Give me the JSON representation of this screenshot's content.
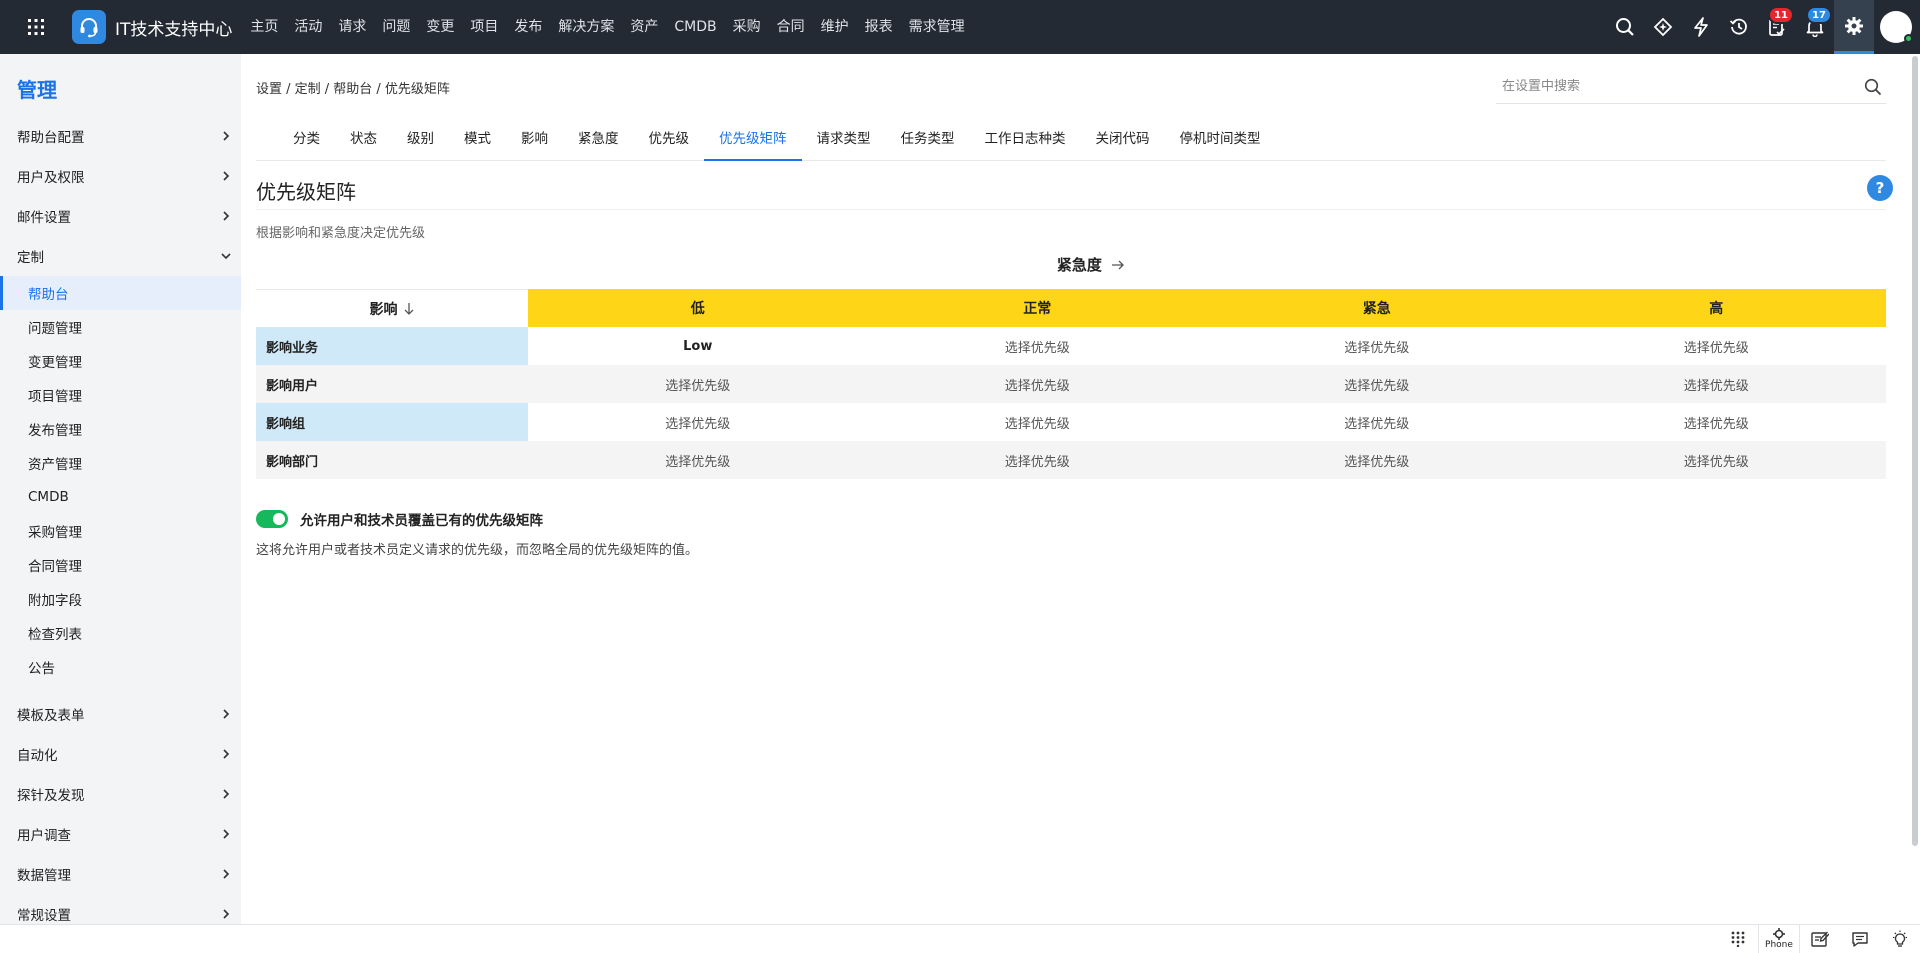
{
  "app": {
    "title": "IT技术支持中心",
    "accent": "#2f89e0",
    "topbar_bg": "#232a33"
  },
  "nav": [
    "主页",
    "活动",
    "请求",
    "问题",
    "变更",
    "项目",
    "发布",
    "解决方案",
    "资产",
    "CMDB",
    "采购",
    "合同",
    "维护",
    "报表",
    "需求管理"
  ],
  "top_icons": {
    "approvals_badge": "11",
    "notifications_badge": "17"
  },
  "sidebar": {
    "title": "管理",
    "groups_top": [
      "帮助台配置",
      "用户及权限",
      "邮件设置"
    ],
    "customize": {
      "label": "定制",
      "items": [
        "帮助台",
        "问题管理",
        "变更管理",
        "项目管理",
        "发布管理",
        "资产管理",
        "CMDB",
        "采购管理",
        "合同管理",
        "附加字段",
        "检查列表",
        "公告"
      ],
      "active_index": 0
    },
    "groups_bottom": [
      "模板及表单",
      "自动化",
      "探针及发现",
      "用户调查",
      "数据管理",
      "常规设置"
    ]
  },
  "breadcrumb": "设置 / 定制 / 帮助台 / 优先级矩阵",
  "settings_search": {
    "placeholder": "在设置中搜索"
  },
  "tabs": [
    "分类",
    "状态",
    "级别",
    "模式",
    "影响",
    "紧急度",
    "优先级",
    "优先级矩阵",
    "请求类型",
    "任务类型",
    "工作日志种类",
    "关闭代码",
    "停机时间类型"
  ],
  "active_tab_index": 7,
  "page": {
    "title": "优先级矩阵",
    "help": "?",
    "description": "根据影响和紧急度决定优先级"
  },
  "matrix": {
    "urgency_label": "紧急度",
    "impact_label": "影响",
    "urgency_levels": [
      "低",
      "正常",
      "紧急",
      "高"
    ],
    "rows": [
      {
        "impact": "影响业务",
        "cells": [
          "Low",
          "选择优先级",
          "选择优先级",
          "选择优先级"
        ]
      },
      {
        "impact": "影响用户",
        "cells": [
          "选择优先级",
          "选择优先级",
          "选择优先级",
          "选择优先级"
        ]
      },
      {
        "impact": "影响组",
        "cells": [
          "选择优先级",
          "选择优先级",
          "选择优先级",
          "选择优先级"
        ]
      },
      {
        "impact": "影响部门",
        "cells": [
          "选择优先级",
          "选择优先级",
          "选择优先级",
          "选择优先级"
        ]
      }
    ],
    "header_color": "#ffd617",
    "impact_highlight_color": "#cfe9f8"
  },
  "override_toggle": {
    "on": true,
    "label": "允许用户和技术员覆盖已有的优先级矩阵",
    "description": "这将允许用户或者技术员定义请求的优先级，而忽略全局的优先级矩阵的值。",
    "color": "#17b85b"
  },
  "footer": {
    "phone_label": "Phone"
  }
}
